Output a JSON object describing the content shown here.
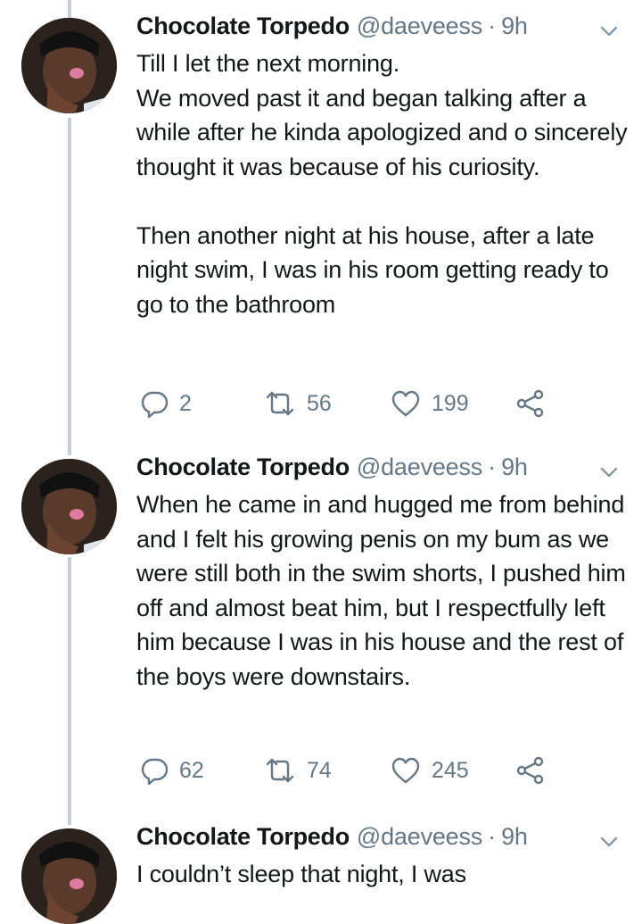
{
  "tweets": [
    {
      "display_name": "Chocolate Torpedo",
      "handle": "@daeveess",
      "separator": "·",
      "time": "9h",
      "text": "Till I let the next morning.\nWe moved past it and began talking after a while after he kinda apologized and o sincerely thought it was because of his curiosity.\n\nThen another night at his house, after a late night swim, I was in his room getting ready to go to the bathroom",
      "replies": "2",
      "retweets": "56",
      "likes": "199"
    },
    {
      "display_name": "Chocolate Torpedo",
      "handle": "@daeveess",
      "separator": "·",
      "time": "9h",
      "text": "When he came in and hugged me from behind and I felt his growing penis on my bum as we were still both in the swim shorts, I pushed him off and almost beat him, but I respectfully left him because I was in his house and the rest of the boys were downstairs.",
      "replies": "62",
      "retweets": "74",
      "likes": "245"
    },
    {
      "display_name": "Chocolate Torpedo",
      "handle": "@daeveess",
      "separator": "·",
      "time": "9h",
      "text": "I couldn’t sleep that night, I was"
    }
  ],
  "icons": {
    "reply": "reply-icon",
    "retweet": "retweet-icon",
    "like": "heart-icon",
    "share": "share-icon",
    "menu": "chevron-down-icon"
  },
  "colors": {
    "text": "#14171a",
    "secondary": "#657786",
    "thread_line": "#c4cfd6"
  }
}
